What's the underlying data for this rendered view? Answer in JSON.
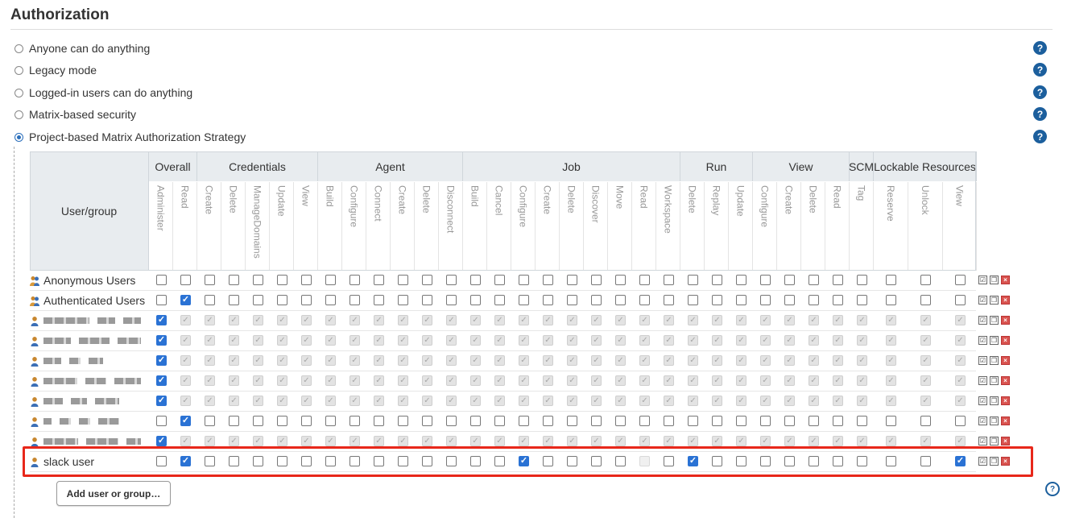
{
  "section": {
    "title": "Authorization"
  },
  "options": [
    {
      "label": "Anyone can do anything",
      "checked": false
    },
    {
      "label": "Legacy mode",
      "checked": false
    },
    {
      "label": "Logged-in users can do anything",
      "checked": false
    },
    {
      "label": "Matrix-based security",
      "checked": false
    },
    {
      "label": "Project-based Matrix Authorization Strategy",
      "checked": true
    }
  ],
  "help_icon": "question-icon",
  "matrix": {
    "user_group_header": "User/group",
    "groups": [
      {
        "name": "Overall",
        "permissions": [
          "Administer",
          "Read"
        ]
      },
      {
        "name": "Credentials",
        "permissions": [
          "Create",
          "Delete",
          "ManageDomains",
          "Update",
          "View"
        ]
      },
      {
        "name": "Agent",
        "permissions": [
          "Build",
          "Configure",
          "Connect",
          "Create",
          "Delete",
          "Disconnect"
        ]
      },
      {
        "name": "Job",
        "permissions": [
          "Build",
          "Cancel",
          "Configure",
          "Create",
          "Delete",
          "Discover",
          "Move",
          "Read",
          "Workspace"
        ]
      },
      {
        "name": "Run",
        "permissions": [
          "Delete",
          "Replay",
          "Update"
        ]
      },
      {
        "name": "View",
        "permissions": [
          "Configure",
          "Create",
          "Delete",
          "Read"
        ]
      },
      {
        "name": "SCM",
        "permissions": [
          "Tag"
        ]
      },
      {
        "name": "Lockable Resources",
        "permissions": [
          "Reserve",
          "Unlock",
          "View"
        ]
      }
    ],
    "rows": [
      {
        "name": "Anonymous Users",
        "icon": "group-icon",
        "checked": [],
        "disabled": []
      },
      {
        "name": "Authenticated Users",
        "icon": "group-icon",
        "checked": [
          1
        ],
        "disabled": []
      },
      {
        "name": "",
        "icon": "user-icon",
        "redacted": [
          58,
          22,
          22
        ],
        "admin": true
      },
      {
        "name": "",
        "icon": "user-icon",
        "redacted": [
          36,
          40,
          30
        ],
        "admin": true
      },
      {
        "name": "",
        "icon": "user-icon",
        "redacted": [
          22,
          14,
          18
        ],
        "admin": true
      },
      {
        "name": "",
        "icon": "user-icon",
        "redacted": [
          46,
          28,
          36
        ],
        "admin": true
      },
      {
        "name": "",
        "icon": "user-icon",
        "redacted": [
          24,
          20,
          30
        ],
        "admin": true
      },
      {
        "name": "",
        "icon": "user-icon",
        "redacted": [
          10,
          14,
          14,
          26
        ],
        "checked": [
          1
        ],
        "disabled": []
      },
      {
        "name": "",
        "icon": "user-icon",
        "redacted": [
          58,
          54,
          24
        ],
        "admin": true
      },
      {
        "name": "slack user",
        "icon": "user-icon",
        "checked": [
          1,
          15,
          22,
          32
        ],
        "disabled": [
          20
        ]
      }
    ],
    "row_actions": [
      "copy-icon",
      "duplicate-icon",
      "delete-icon"
    ]
  },
  "add_button": {
    "label": "Add user or group…"
  }
}
